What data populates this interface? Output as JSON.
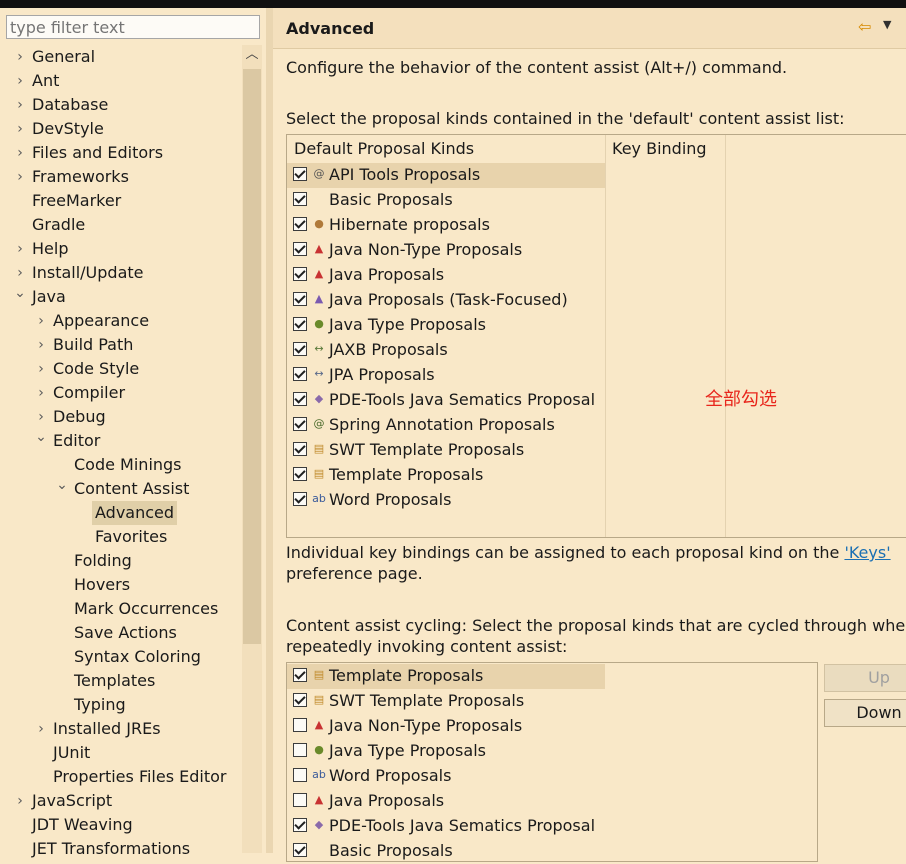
{
  "filter": {
    "placeholder": "type filter text"
  },
  "tree": [
    {
      "label": "General",
      "level": 0,
      "arrow": "›"
    },
    {
      "label": "Ant",
      "level": 0,
      "arrow": "›"
    },
    {
      "label": "Database",
      "level": 0,
      "arrow": "›"
    },
    {
      "label": "DevStyle",
      "level": 0,
      "arrow": "›"
    },
    {
      "label": "Files and Editors",
      "level": 0,
      "arrow": "›"
    },
    {
      "label": "Frameworks",
      "level": 0,
      "arrow": "›"
    },
    {
      "label": "FreeMarker",
      "level": 0,
      "arrow": ""
    },
    {
      "label": "Gradle",
      "level": 0,
      "arrow": ""
    },
    {
      "label": "Help",
      "level": 0,
      "arrow": "›"
    },
    {
      "label": "Install/Update",
      "level": 0,
      "arrow": "›"
    },
    {
      "label": "Java",
      "level": 0,
      "arrow": "⌄"
    },
    {
      "label": "Appearance",
      "level": 1,
      "arrow": "›"
    },
    {
      "label": "Build Path",
      "level": 1,
      "arrow": "›"
    },
    {
      "label": "Code Style",
      "level": 1,
      "arrow": "›"
    },
    {
      "label": "Compiler",
      "level": 1,
      "arrow": "›"
    },
    {
      "label": "Debug",
      "level": 1,
      "arrow": "›"
    },
    {
      "label": "Editor",
      "level": 1,
      "arrow": "⌄"
    },
    {
      "label": "Code Minings",
      "level": 2,
      "arrow": ""
    },
    {
      "label": "Content Assist",
      "level": 2,
      "arrow": "⌄"
    },
    {
      "label": "Advanced",
      "level": 3,
      "arrow": "",
      "selected": true
    },
    {
      "label": "Favorites",
      "level": 3,
      "arrow": ""
    },
    {
      "label": "Folding",
      "level": 2,
      "arrow": ""
    },
    {
      "label": "Hovers",
      "level": 2,
      "arrow": ""
    },
    {
      "label": "Mark Occurrences",
      "level": 2,
      "arrow": ""
    },
    {
      "label": "Save Actions",
      "level": 2,
      "arrow": ""
    },
    {
      "label": "Syntax Coloring",
      "level": 2,
      "arrow": ""
    },
    {
      "label": "Templates",
      "level": 2,
      "arrow": ""
    },
    {
      "label": "Typing",
      "level": 2,
      "arrow": ""
    },
    {
      "label": "Installed JREs",
      "level": 1,
      "arrow": "›"
    },
    {
      "label": "JUnit",
      "level": 1,
      "arrow": ""
    },
    {
      "label": "Properties Files Editor",
      "level": 1,
      "arrow": ""
    },
    {
      "label": "JavaScript",
      "level": 0,
      "arrow": "›"
    },
    {
      "label": "JDT Weaving",
      "level": 0,
      "arrow": ""
    },
    {
      "label": "JET Transformations",
      "level": 0,
      "arrow": ""
    }
  ],
  "header": {
    "title": "Advanced",
    "back_icon": "back-arrow-icon",
    "menu_icon": "view-menu-icon"
  },
  "description": "Configure the behavior of the content assist (Alt+/) command.",
  "default_section": {
    "label": "Select the proposal kinds contained in the 'default' content assist list:",
    "col1": "Default Proposal Kinds",
    "col2": "Key Binding",
    "rows": [
      {
        "label": "API Tools Proposals",
        "checked": true,
        "icon": "@",
        "color": "#555555",
        "highlight": true
      },
      {
        "label": "Basic Proposals",
        "checked": true,
        "icon": "",
        "color": "#555555"
      },
      {
        "label": "Hibernate proposals",
        "checked": true,
        "icon": "●",
        "color": "#b07a3a"
      },
      {
        "label": "Java Non-Type Proposals",
        "checked": true,
        "icon": "▲",
        "color": "#c83232"
      },
      {
        "label": "Java Proposals",
        "checked": true,
        "icon": "▲",
        "color": "#c83232"
      },
      {
        "label": "Java Proposals (Task-Focused)",
        "checked": true,
        "icon": "▲",
        "color": "#7a5ab0"
      },
      {
        "label": "Java Type Proposals",
        "checked": true,
        "icon": "●",
        "color": "#6a8a2a"
      },
      {
        "label": "JAXB Proposals",
        "checked": true,
        "icon": "↔",
        "color": "#5a7a3a"
      },
      {
        "label": "JPA Proposals",
        "checked": true,
        "icon": "↔",
        "color": "#5a6a8a"
      },
      {
        "label": "PDE-Tools Java Sematics Proposal",
        "checked": true,
        "icon": "◆",
        "color": "#8a6aaa"
      },
      {
        "label": "Spring Annotation Proposals",
        "checked": true,
        "icon": "@",
        "color": "#4a6a2a"
      },
      {
        "label": "SWT Template Proposals",
        "checked": true,
        "icon": "▤",
        "color": "#c08a2a"
      },
      {
        "label": "Template Proposals",
        "checked": true,
        "icon": "▤",
        "color": "#c08a2a"
      },
      {
        "label": "Word Proposals",
        "checked": true,
        "icon": "ab",
        "color": "#3a5a9a"
      }
    ],
    "annotation": "全部勾选"
  },
  "keys_note": {
    "text1": "Individual key bindings can be assigned to each proposal kind on the ",
    "link": "'Keys'",
    "text2": "preference page."
  },
  "cycling_section": {
    "label1": "Content assist cycling: Select the proposal kinds that are cycled through when",
    "label2": "repeatedly invoking content assist:",
    "rows": [
      {
        "label": "Template Proposals",
        "checked": true,
        "icon": "▤",
        "color": "#c08a2a",
        "highlight": true
      },
      {
        "label": "SWT Template Proposals",
        "checked": true,
        "icon": "▤",
        "color": "#c08a2a"
      },
      {
        "label": "Java Non-Type Proposals",
        "checked": false,
        "icon": "▲",
        "color": "#c83232"
      },
      {
        "label": "Java Type Proposals",
        "checked": false,
        "icon": "●",
        "color": "#6a8a2a"
      },
      {
        "label": "Word Proposals",
        "checked": false,
        "icon": "ab",
        "color": "#3a5a9a"
      },
      {
        "label": "Java Proposals",
        "checked": false,
        "icon": "▲",
        "color": "#c83232"
      },
      {
        "label": "PDE-Tools Java Sematics Proposal",
        "checked": true,
        "icon": "◆",
        "color": "#8a6aaa"
      },
      {
        "label": "Basic Proposals",
        "checked": true,
        "icon": "",
        "color": "#555555"
      }
    ],
    "up_label": "Up",
    "down_label": "Down"
  }
}
